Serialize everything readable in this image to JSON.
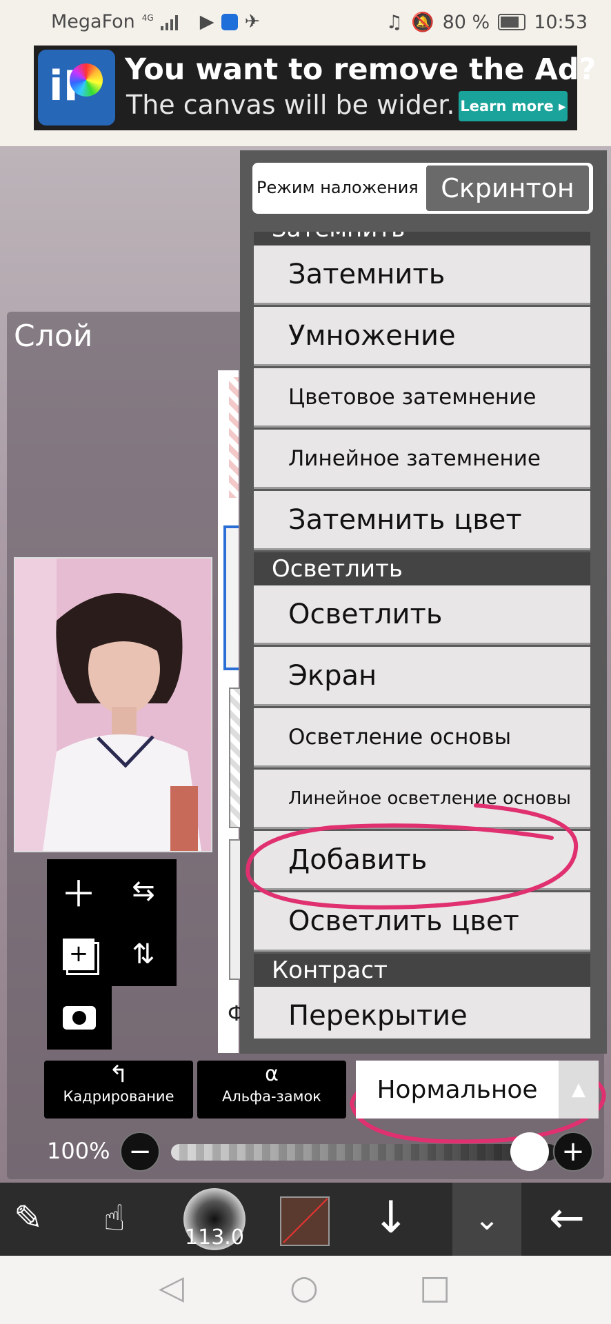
{
  "status_bar": {
    "carrier": "MegaFon",
    "network": "4G",
    "battery": "80 %",
    "time": "10:53"
  },
  "ad": {
    "headline": "You want to remove the Ad?",
    "subline": "The canvas will be wider.",
    "button_label": "Learn more ▸",
    "logo_text": "iP"
  },
  "layer_panel": {
    "title": "Слой",
    "layer_letter": "Ф"
  },
  "blend_dropdown": {
    "header_label": "Режим наложения",
    "tab_label": "Скринтон",
    "items": [
      {
        "kind": "section",
        "label": "Затемнить"
      },
      {
        "kind": "item",
        "label": "Затемнить"
      },
      {
        "kind": "item",
        "label": "Умножение"
      },
      {
        "kind": "item",
        "label": "Цветовое затемнение"
      },
      {
        "kind": "item",
        "label": "Линейное затемнение"
      },
      {
        "kind": "item",
        "label": "Затемнить цвет"
      },
      {
        "kind": "section",
        "label": "Осветлить"
      },
      {
        "kind": "item",
        "label": "Осветлить"
      },
      {
        "kind": "item",
        "label": "Экран"
      },
      {
        "kind": "item",
        "label": "Осветление основы"
      },
      {
        "kind": "item",
        "label": "Линейное осветление основы"
      },
      {
        "kind": "item",
        "label": "Добавить"
      },
      {
        "kind": "item",
        "label": "Осветлить цвет"
      },
      {
        "kind": "section",
        "label": "Контраст"
      },
      {
        "kind": "item",
        "label": "Перекрытие"
      }
    ]
  },
  "layer_controls": {
    "crop_label": "Кадрирование",
    "alpha_lock_label": "Альфа-замок",
    "blend_mode_value": "Нормальное",
    "opacity": "100%",
    "opacity_fraction": 1.0
  },
  "toolbar": {
    "brush_size": "113.0"
  },
  "colors": {
    "annotation": "#e0306f",
    "accent_teal": "#1aa39a",
    "selected_border": "#2b6fd6"
  }
}
